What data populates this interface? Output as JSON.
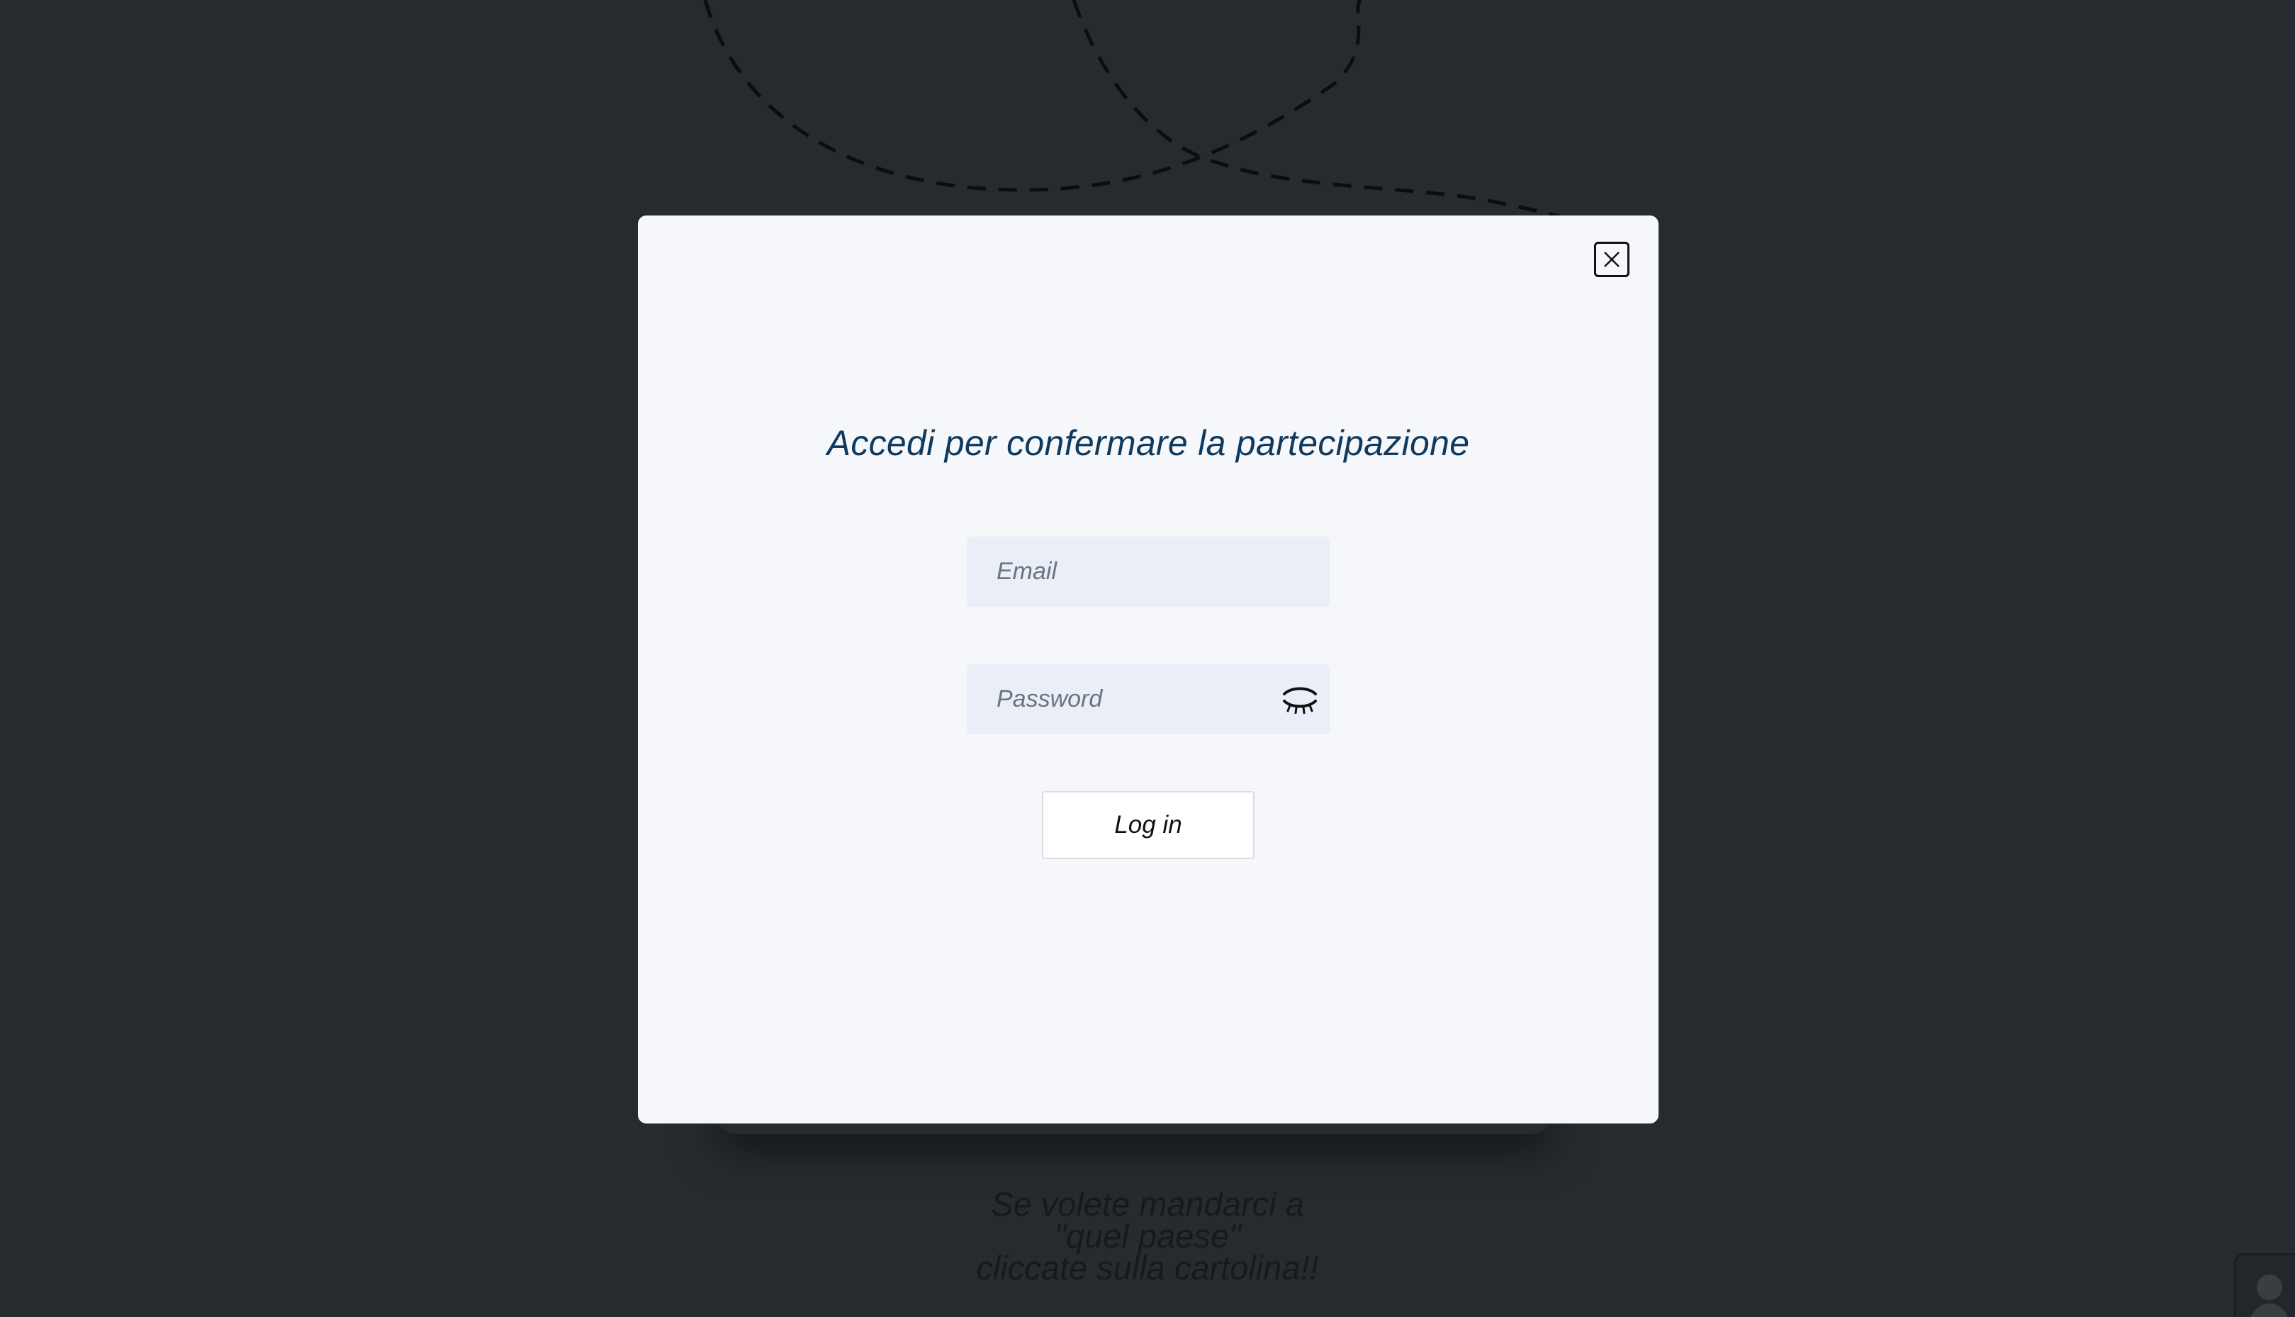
{
  "modal": {
    "title": "Accedi per confermare la partecipazione",
    "email": {
      "placeholder": "Email",
      "value": ""
    },
    "password": {
      "placeholder": "Password",
      "value": ""
    },
    "login_label": "Log in",
    "close_icon": "close-icon",
    "visibility_icon": "eye-closed-icon"
  },
  "background": {
    "message_lines": [
      "Se volete mandarci a",
      "\"quel paese\"",
      "cliccate sulla cartolina!!"
    ],
    "corner_icon": "avatar"
  },
  "colors": {
    "backdrop": "#272a2f",
    "modal_bg": "#f5f7fa",
    "title": "#0f3a5f",
    "input_bg": "#e9eef7"
  }
}
